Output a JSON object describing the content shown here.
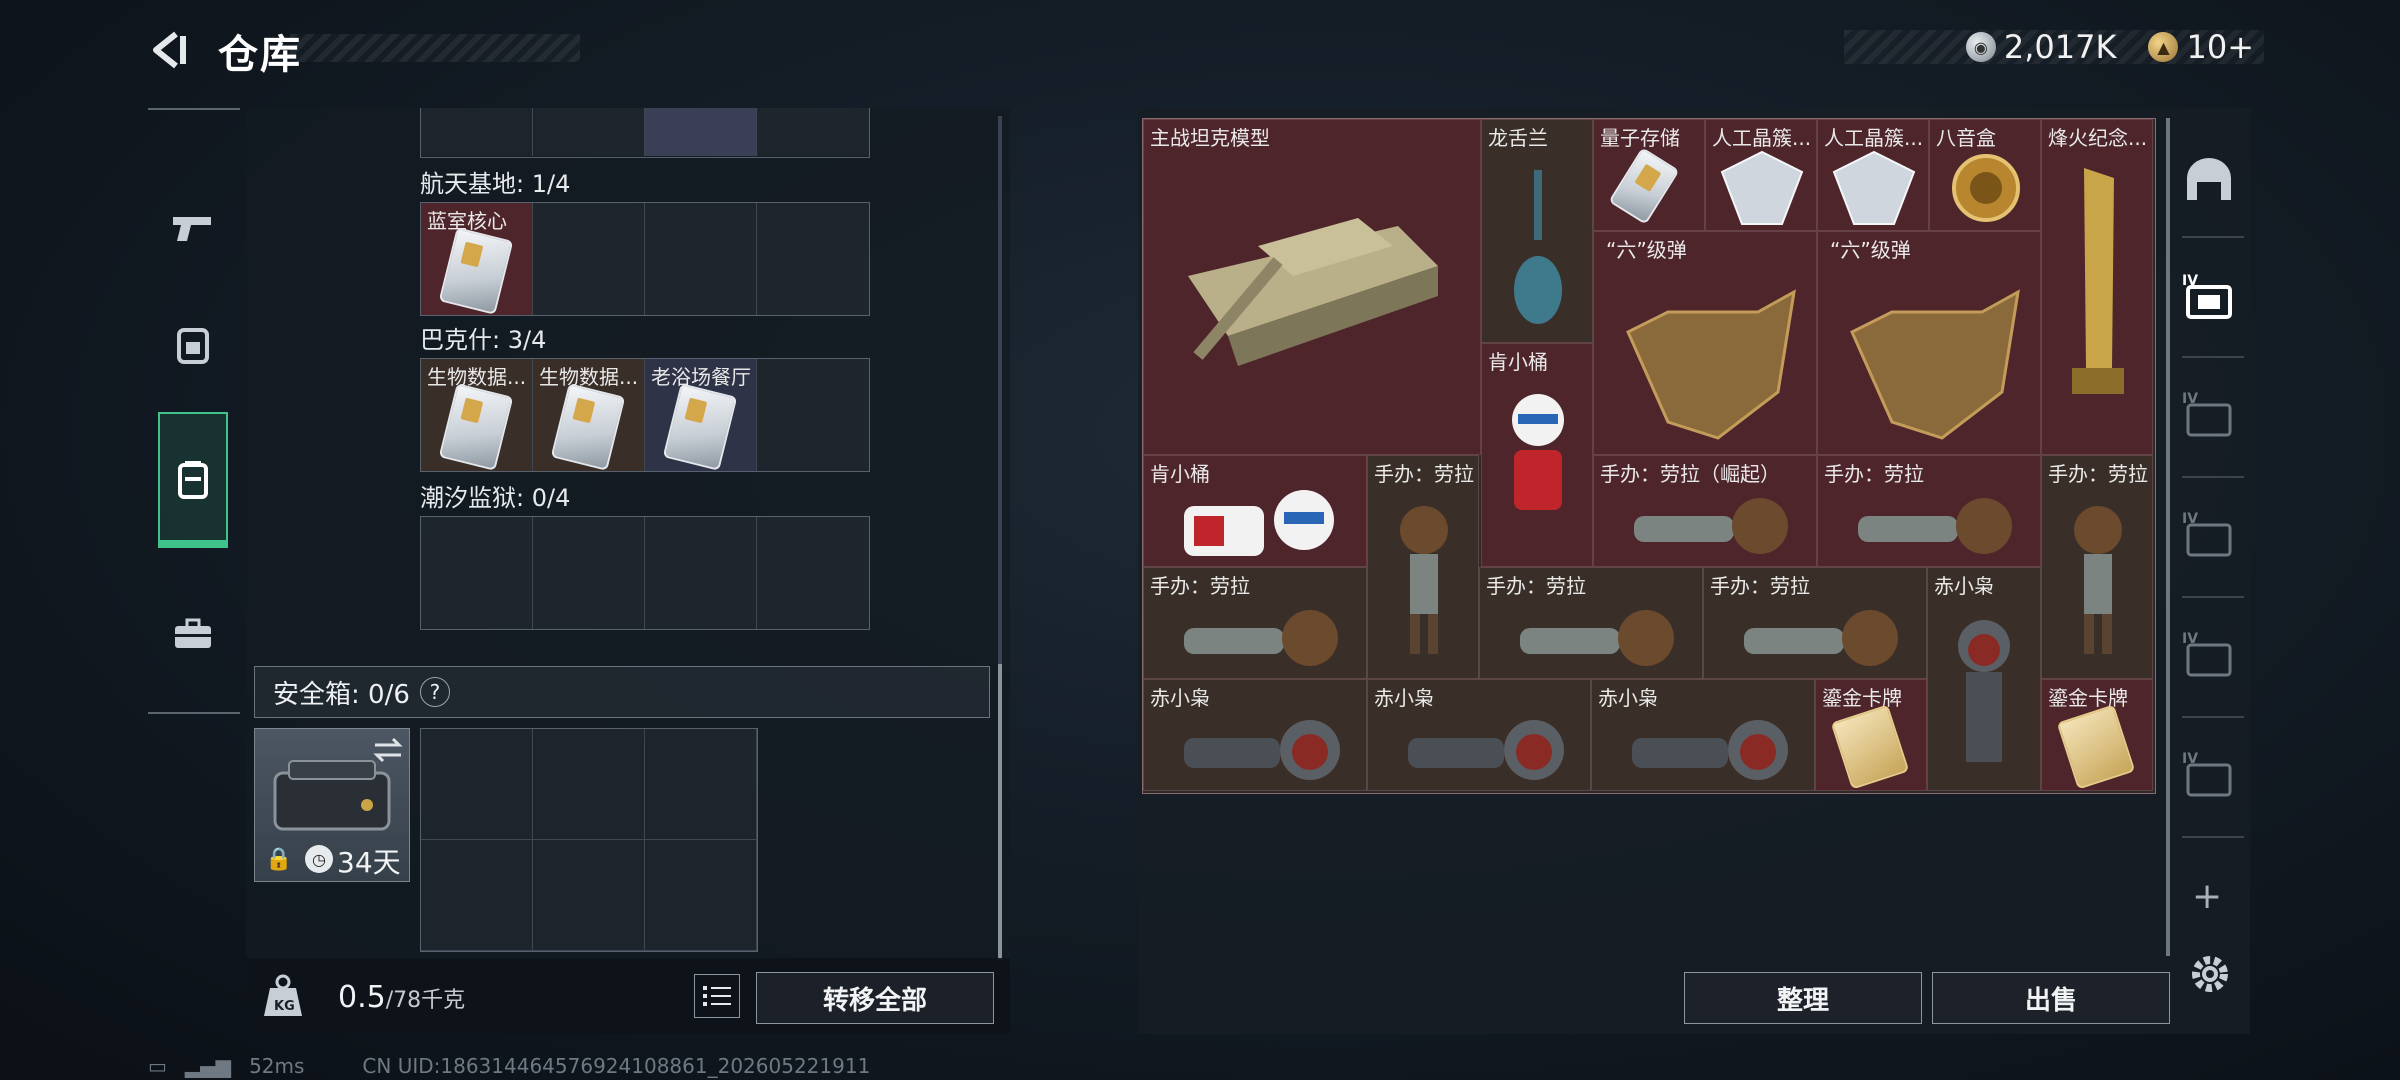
{
  "header": {
    "title": "仓库",
    "currency_silver": "2,017K",
    "currency_gold": "10+"
  },
  "left_nav": {
    "items": [
      "weapon",
      "backpack",
      "container",
      "case"
    ],
    "active_index": 2
  },
  "sections": [
    {
      "label": "航天基地: 1/4",
      "slots": [
        "蓝室核心",
        "",
        "",
        ""
      ]
    },
    {
      "label": "巴克什: 3/4",
      "slots": [
        "生物数据...",
        "生物数据...",
        "老浴场餐厅",
        ""
      ]
    },
    {
      "label": "潮汐监狱: 0/4",
      "slots": [
        "",
        "",
        "",
        ""
      ]
    }
  ],
  "safe": {
    "label": "安全箱: 0/6",
    "help": "?",
    "days": "34天"
  },
  "weight": {
    "current": "0.5",
    "max": "/78千克"
  },
  "buttons": {
    "transfer": "转移全部",
    "sort": "整理",
    "sell": "出售"
  },
  "items": {
    "tank": "主战坦克模型",
    "longshelan": "龙舌兰",
    "quantum": "量子存储",
    "crystal1": "人工晶簇...",
    "crystal2": "人工晶簇...",
    "bayin": "八音盒",
    "fenghuo": "烽火纪念...",
    "kentong": "肯小桶",
    "liuji1": "“六”级弹",
    "liuji2": "“六”级弹",
    "kentong2": "肯小桶",
    "laura1": "手办：劳拉",
    "laura_rise": "手办：劳拉（崛起）",
    "laura2": "手办：劳拉",
    "laura3": "手办：劳拉",
    "laura4": "手办：劳拉",
    "laura5": "手办：劳拉",
    "laura6": "手办：劳拉",
    "chixiao1": "赤小枭",
    "chixiao2": "赤小枭",
    "chixiao3": "赤小枭",
    "chixiao4": "赤小枭",
    "gold1": "鎏金卡牌",
    "gold2": "鎏金卡牌"
  },
  "status": {
    "ping": "52ms",
    "uid": "CN UID:1863144645769241088​61_202605221911"
  },
  "colors": {
    "accent": "#3fc38a",
    "rare_red": "#4e252b",
    "brown": "#3a2f28"
  }
}
